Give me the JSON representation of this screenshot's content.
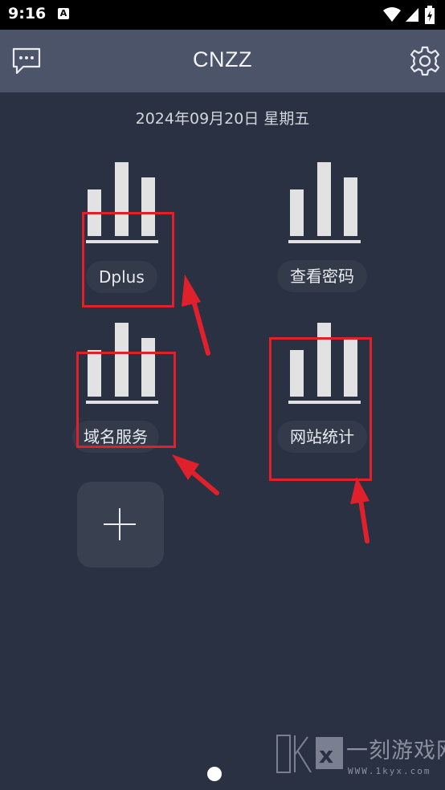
{
  "status_bar": {
    "time": "9:16",
    "notification_icon": "A"
  },
  "app_bar": {
    "title": "CNZZ",
    "left_icon": "message-icon",
    "right_icon": "gear-icon"
  },
  "date": "2024年09月20日 星期五",
  "tiles": [
    {
      "label": "Dplus",
      "icon": "bar-chart-icon"
    },
    {
      "label": "查看密码",
      "icon": "bar-chart-icon"
    },
    {
      "label": "域名服务",
      "icon": "bar-chart-icon"
    },
    {
      "label": "网站统计",
      "icon": "bar-chart-icon"
    }
  ],
  "add_button": {
    "icon": "plus-icon"
  },
  "watermark": {
    "brand": "一刻游戏网",
    "url": "WWW.1kyx.com"
  },
  "colors": {
    "background": "#2a3142",
    "app_bar": "#4b5468",
    "annotation": "#e0202a"
  }
}
